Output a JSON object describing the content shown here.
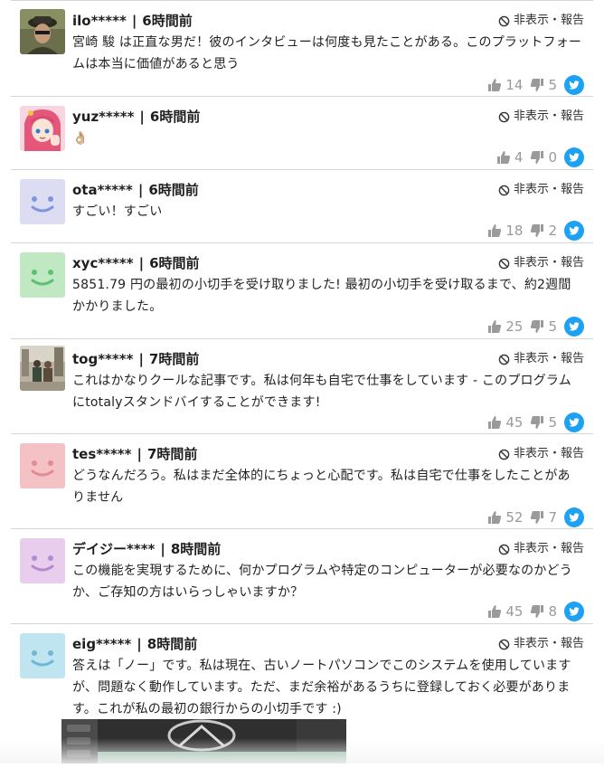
{
  "ui": {
    "hide_label": "非表示・報告",
    "separator": "|",
    "colors": {
      "twitter": "#1da1f2",
      "divider": "#d6d6d6",
      "vote_text": "#9a9a9a"
    }
  },
  "comments": [
    {
      "user": "ilo*****",
      "time": "6時間前",
      "text": "宮崎 駿 は正直な男だ！彼のインタビューは何度も見たことがある。このプラットフォームは本当に価値があると思う",
      "likes": "14",
      "dislikes": "5",
      "avatar": "photo-man-hat"
    },
    {
      "user": "yuz*****",
      "time": "6時間前",
      "text": "👌🏼",
      "likes": "4",
      "dislikes": "0",
      "avatar": "anime-girl-pink-hair"
    },
    {
      "user": "ota*****",
      "time": "6時間前",
      "text": "すごい！すごい",
      "likes": "18",
      "dislikes": "2",
      "avatar": "smiley-icon",
      "avatar_color": "#dcdcf3",
      "face_color": "#7e95e0"
    },
    {
      "user": "xyc*****",
      "time": "6時間前",
      "text": "5851.79 円の最初の小切手を受け取りました! 最初の小切手を受け取るまで、約2週間かかりました。",
      "likes": "25",
      "dislikes": "5",
      "avatar": "smiley-icon",
      "avatar_color": "#bfe8c3",
      "face_color": "#5fbf73"
    },
    {
      "user": "tog*****",
      "time": "7時間前",
      "text": "これはかなりクールな記事です。私は何年も自宅で仕事をしています - このプログラムにtotalyスタンドバイすることができます!",
      "likes": "45",
      "dislikes": "5",
      "avatar": "photo-two-people-street"
    },
    {
      "user": "tes*****",
      "time": "7時間前",
      "text": "どうなんだろう。私はまだ全体的にちょっと心配です。私は自宅で仕事をしたことがありません",
      "likes": "52",
      "dislikes": "7",
      "avatar": "smiley-icon",
      "avatar_color": "#f4c1c5",
      "face_color": "#e58a92"
    },
    {
      "user": "デイジー****",
      "time": "8時間前",
      "text": "この機能を実現するために、何かプログラムや特定のコンピューターが必要なのかどうか、ご存知の方はいらっしゃいますか？",
      "likes": "45",
      "dislikes": "8",
      "avatar": "smiley-icon",
      "avatar_color": "#e8cdec",
      "face_color": "#b68ad0"
    },
    {
      "user": "eig*****",
      "time": "8時間前",
      "text": "答えは「ノー」です。私は現在、古いノートパソコンでこのシステムを使用していますが、問題なく動作しています。ただ、まだ余裕があるうちに登録しておく必要があります。これが私の最初の銀行からの小切手です :)",
      "avatar": "smiley-icon",
      "avatar_color": "#bfe6f0",
      "face_color": "#6fb7d3",
      "attachment": "car-dashboard-photo"
    }
  ]
}
